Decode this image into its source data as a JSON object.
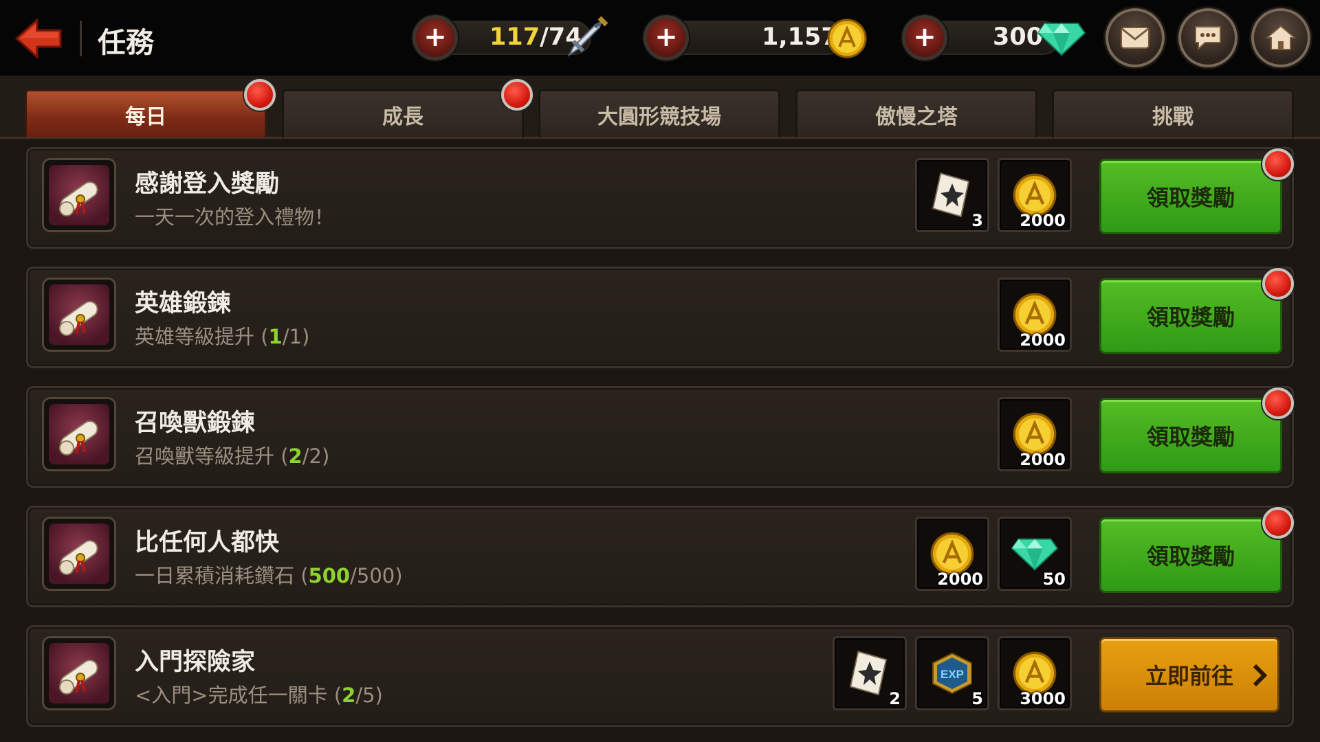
{
  "header": {
    "title": "任務",
    "stamina": {
      "current": "117",
      "rest": "/74"
    },
    "gold": "1,157",
    "gems": "300"
  },
  "tabs": [
    {
      "label": "每日",
      "active": true,
      "badge": true
    },
    {
      "label": "成長",
      "active": false,
      "badge": true
    },
    {
      "label": "大圓形競技場",
      "active": false,
      "badge": false
    },
    {
      "label": "傲慢之塔",
      "active": false,
      "badge": false
    },
    {
      "label": "挑戰",
      "active": false,
      "badge": false
    }
  ],
  "quests": [
    {
      "title": "感謝登入獎勵",
      "desc": "一天一次的登入禮物！",
      "rewards": [
        {
          "icon": "scroll-item-icon",
          "count": "3"
        },
        {
          "icon": "gold-coin-icon",
          "count": "2000"
        }
      ],
      "button": "領取獎勵"
    },
    {
      "title": "英雄鍛鍊",
      "desc_prefix": "英雄等級提升 (",
      "desc_done": "1",
      "desc_total": "/1)",
      "rewards": [
        {
          "icon": "gold-coin-icon",
          "count": "2000"
        }
      ],
      "button": "領取獎勵"
    },
    {
      "title": "召喚獸鍛鍊",
      "desc_prefix": "召喚獸等級提升 (",
      "desc_done": "2",
      "desc_total": "/2)",
      "rewards": [
        {
          "icon": "gold-coin-icon",
          "count": "2000"
        }
      ],
      "button": "領取獎勵"
    },
    {
      "title": "比任何人都快",
      "desc_prefix": "一日累積消耗鑽石 (",
      "desc_done": "500",
      "desc_total": "/500)",
      "rewards": [
        {
          "icon": "gold-coin-icon",
          "count": "2000"
        },
        {
          "icon": "diamond-icon",
          "count": "50"
        }
      ],
      "button": "領取獎勵"
    },
    {
      "title": "入門探險家",
      "desc_prefix": "<入門>完成任一關卡 (",
      "desc_done": "2",
      "desc_total": "/5)",
      "rewards": [
        {
          "icon": "scroll-item-icon",
          "count": "2"
        },
        {
          "icon": "exp-badge-icon",
          "count": "5"
        },
        {
          "icon": "gold-coin-icon",
          "count": "3000"
        }
      ],
      "button": "立即前往"
    }
  ],
  "colors": {
    "progress_done": "#8ed22d",
    "claim_button": "#3fa81b",
    "go_button": "#e29a0e",
    "active_tab": "#8c3418",
    "badge_red": "#d51a10"
  }
}
